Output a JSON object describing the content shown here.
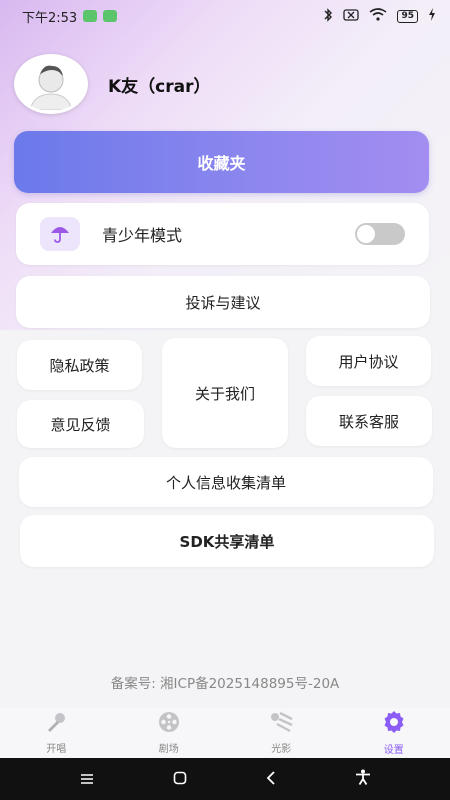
{
  "status_bar": {
    "time": "下午2:53",
    "battery": "95",
    "bluetooth_icon": "bluetooth-icon",
    "wifi_icon": "wifi-icon",
    "charging_icon": "lightning-icon"
  },
  "profile": {
    "username": "K友（crar）"
  },
  "favorites": {
    "label": "收藏夹"
  },
  "teen_mode": {
    "label": "青少年模式",
    "enabled": false,
    "icon": "umbrella-icon"
  },
  "menu": {
    "complaint": "投诉与建议",
    "privacy": "隐私政策",
    "feedback": "意见反馈",
    "about": "关于我们",
    "user_agreement": "用户协议",
    "support": "联系客服",
    "personal_info": "个人信息收集清单",
    "sdk": "SDK共享清单"
  },
  "icp": "备案号: 湘ICP备2025148895号-20A",
  "tabs": [
    {
      "label": "开唱",
      "icon": "microphone-icon"
    },
    {
      "label": "剧场",
      "icon": "film-reel-icon"
    },
    {
      "label": "光影",
      "icon": "light-icon"
    },
    {
      "label": "设置",
      "icon": "gear-icon",
      "active": true
    }
  ],
  "nav": {
    "menu_icon": "menu-icon",
    "home_icon": "home-icon",
    "back_icon": "back-icon",
    "accessibility_icon": "accessibility-icon"
  },
  "colors": {
    "accent": "#8b5cf6",
    "button_gradient_start": "#6b79ea",
    "button_gradient_end": "#a38df0"
  }
}
